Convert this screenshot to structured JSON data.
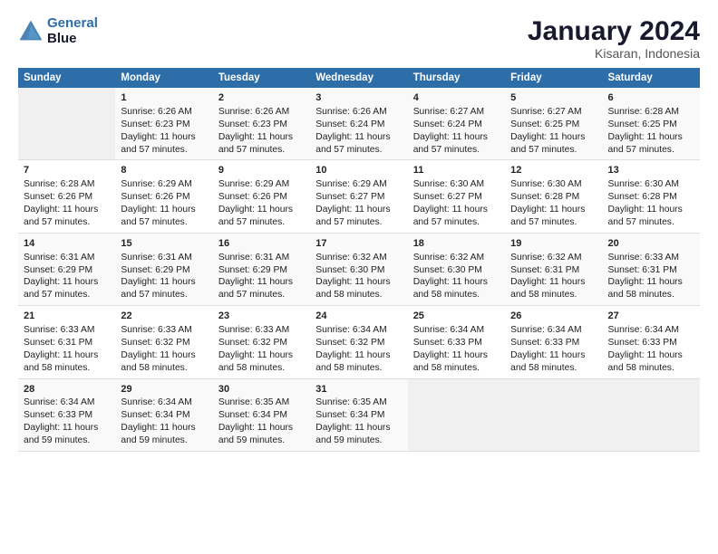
{
  "header": {
    "logo_line1": "General",
    "logo_line2": "Blue",
    "main_title": "January 2024",
    "subtitle": "Kisaran, Indonesia"
  },
  "days_of_week": [
    "Sunday",
    "Monday",
    "Tuesday",
    "Wednesday",
    "Thursday",
    "Friday",
    "Saturday"
  ],
  "weeks": [
    [
      {
        "day": "",
        "empty": true
      },
      {
        "day": "1",
        "sunrise": "Sunrise: 6:26 AM",
        "sunset": "Sunset: 6:23 PM",
        "daylight": "Daylight: 11 hours and 57 minutes."
      },
      {
        "day": "2",
        "sunrise": "Sunrise: 6:26 AM",
        "sunset": "Sunset: 6:23 PM",
        "daylight": "Daylight: 11 hours and 57 minutes."
      },
      {
        "day": "3",
        "sunrise": "Sunrise: 6:26 AM",
        "sunset": "Sunset: 6:24 PM",
        "daylight": "Daylight: 11 hours and 57 minutes."
      },
      {
        "day": "4",
        "sunrise": "Sunrise: 6:27 AM",
        "sunset": "Sunset: 6:24 PM",
        "daylight": "Daylight: 11 hours and 57 minutes."
      },
      {
        "day": "5",
        "sunrise": "Sunrise: 6:27 AM",
        "sunset": "Sunset: 6:25 PM",
        "daylight": "Daylight: 11 hours and 57 minutes."
      },
      {
        "day": "6",
        "sunrise": "Sunrise: 6:28 AM",
        "sunset": "Sunset: 6:25 PM",
        "daylight": "Daylight: 11 hours and 57 minutes."
      }
    ],
    [
      {
        "day": "7",
        "sunrise": "Sunrise: 6:28 AM",
        "sunset": "Sunset: 6:26 PM",
        "daylight": "Daylight: 11 hours and 57 minutes."
      },
      {
        "day": "8",
        "sunrise": "Sunrise: 6:29 AM",
        "sunset": "Sunset: 6:26 PM",
        "daylight": "Daylight: 11 hours and 57 minutes."
      },
      {
        "day": "9",
        "sunrise": "Sunrise: 6:29 AM",
        "sunset": "Sunset: 6:26 PM",
        "daylight": "Daylight: 11 hours and 57 minutes."
      },
      {
        "day": "10",
        "sunrise": "Sunrise: 6:29 AM",
        "sunset": "Sunset: 6:27 PM",
        "daylight": "Daylight: 11 hours and 57 minutes."
      },
      {
        "day": "11",
        "sunrise": "Sunrise: 6:30 AM",
        "sunset": "Sunset: 6:27 PM",
        "daylight": "Daylight: 11 hours and 57 minutes."
      },
      {
        "day": "12",
        "sunrise": "Sunrise: 6:30 AM",
        "sunset": "Sunset: 6:28 PM",
        "daylight": "Daylight: 11 hours and 57 minutes."
      },
      {
        "day": "13",
        "sunrise": "Sunrise: 6:30 AM",
        "sunset": "Sunset: 6:28 PM",
        "daylight": "Daylight: 11 hours and 57 minutes."
      }
    ],
    [
      {
        "day": "14",
        "sunrise": "Sunrise: 6:31 AM",
        "sunset": "Sunset: 6:29 PM",
        "daylight": "Daylight: 11 hours and 57 minutes."
      },
      {
        "day": "15",
        "sunrise": "Sunrise: 6:31 AM",
        "sunset": "Sunset: 6:29 PM",
        "daylight": "Daylight: 11 hours and 57 minutes."
      },
      {
        "day": "16",
        "sunrise": "Sunrise: 6:31 AM",
        "sunset": "Sunset: 6:29 PM",
        "daylight": "Daylight: 11 hours and 57 minutes."
      },
      {
        "day": "17",
        "sunrise": "Sunrise: 6:32 AM",
        "sunset": "Sunset: 6:30 PM",
        "daylight": "Daylight: 11 hours and 58 minutes."
      },
      {
        "day": "18",
        "sunrise": "Sunrise: 6:32 AM",
        "sunset": "Sunset: 6:30 PM",
        "daylight": "Daylight: 11 hours and 58 minutes."
      },
      {
        "day": "19",
        "sunrise": "Sunrise: 6:32 AM",
        "sunset": "Sunset: 6:31 PM",
        "daylight": "Daylight: 11 hours and 58 minutes."
      },
      {
        "day": "20",
        "sunrise": "Sunrise: 6:33 AM",
        "sunset": "Sunset: 6:31 PM",
        "daylight": "Daylight: 11 hours and 58 minutes."
      }
    ],
    [
      {
        "day": "21",
        "sunrise": "Sunrise: 6:33 AM",
        "sunset": "Sunset: 6:31 PM",
        "daylight": "Daylight: 11 hours and 58 minutes."
      },
      {
        "day": "22",
        "sunrise": "Sunrise: 6:33 AM",
        "sunset": "Sunset: 6:32 PM",
        "daylight": "Daylight: 11 hours and 58 minutes."
      },
      {
        "day": "23",
        "sunrise": "Sunrise: 6:33 AM",
        "sunset": "Sunset: 6:32 PM",
        "daylight": "Daylight: 11 hours and 58 minutes."
      },
      {
        "day": "24",
        "sunrise": "Sunrise: 6:34 AM",
        "sunset": "Sunset: 6:32 PM",
        "daylight": "Daylight: 11 hours and 58 minutes."
      },
      {
        "day": "25",
        "sunrise": "Sunrise: 6:34 AM",
        "sunset": "Sunset: 6:33 PM",
        "daylight": "Daylight: 11 hours and 58 minutes."
      },
      {
        "day": "26",
        "sunrise": "Sunrise: 6:34 AM",
        "sunset": "Sunset: 6:33 PM",
        "daylight": "Daylight: 11 hours and 58 minutes."
      },
      {
        "day": "27",
        "sunrise": "Sunrise: 6:34 AM",
        "sunset": "Sunset: 6:33 PM",
        "daylight": "Daylight: 11 hours and 58 minutes."
      }
    ],
    [
      {
        "day": "28",
        "sunrise": "Sunrise: 6:34 AM",
        "sunset": "Sunset: 6:33 PM",
        "daylight": "Daylight: 11 hours and 59 minutes."
      },
      {
        "day": "29",
        "sunrise": "Sunrise: 6:34 AM",
        "sunset": "Sunset: 6:34 PM",
        "daylight": "Daylight: 11 hours and 59 minutes."
      },
      {
        "day": "30",
        "sunrise": "Sunrise: 6:35 AM",
        "sunset": "Sunset: 6:34 PM",
        "daylight": "Daylight: 11 hours and 59 minutes."
      },
      {
        "day": "31",
        "sunrise": "Sunrise: 6:35 AM",
        "sunset": "Sunset: 6:34 PM",
        "daylight": "Daylight: 11 hours and 59 minutes."
      },
      {
        "day": "",
        "empty": true
      },
      {
        "day": "",
        "empty": true
      },
      {
        "day": "",
        "empty": true
      }
    ]
  ]
}
